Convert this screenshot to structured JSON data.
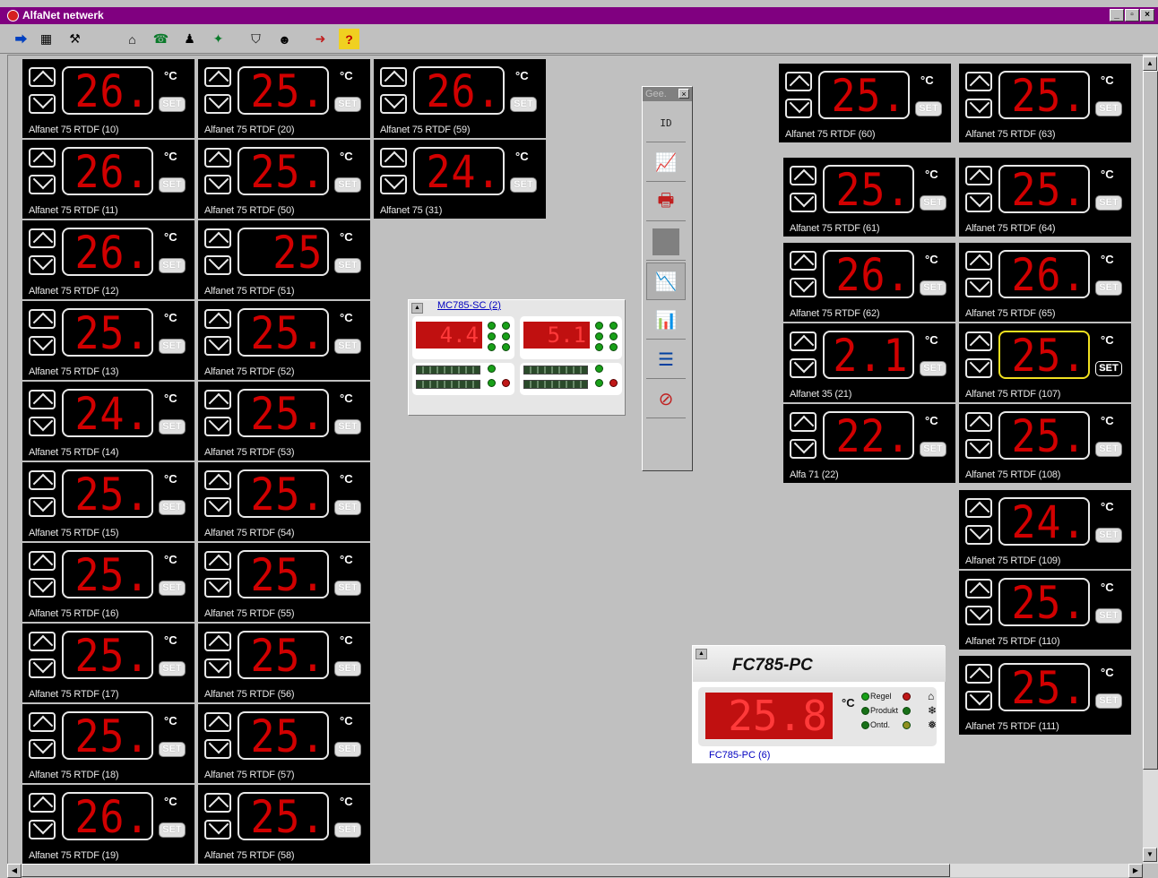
{
  "window": {
    "title": "AlfaNet netwerk",
    "minimize": "_",
    "maximize": "▫",
    "close": "×"
  },
  "toolbar_icons": [
    "exit-icon",
    "table-icon",
    "tools-icon",
    "fan-icon",
    "phone-icon",
    "network-icon",
    "run-icon",
    "lock-icon",
    "user-icon",
    "logout-icon",
    "help-icon"
  ],
  "controllers": [
    {
      "value": "26.4",
      "label": "Alfanet 75 RTDF (10)"
    },
    {
      "value": "26.0",
      "label": "Alfanet 75 RTDF (11)"
    },
    {
      "value": "26.3",
      "label": "Alfanet 75 RTDF (12)"
    },
    {
      "value": "25.4",
      "label": "Alfanet 75 RTDF (13)"
    },
    {
      "value": "24.9",
      "label": "Alfanet 75 RTDF (14)"
    },
    {
      "value": "25.7",
      "label": "Alfanet 75 RTDF (15)"
    },
    {
      "value": "25.2",
      "label": "Alfanet 75 RTDF (16)"
    },
    {
      "value": "25.7",
      "label": "Alfanet 75 RTDF (17)"
    },
    {
      "value": "25.4",
      "label": "Alfanet 75 RTDF (18)"
    },
    {
      "value": "26.0",
      "label": "Alfanet 75 RTDF (19)"
    },
    {
      "value": "25.9",
      "label": "Alfanet 75 RTDF (20)"
    },
    {
      "value": "25.7",
      "label": "Alfanet 75 RTDF (50)"
    },
    {
      "value": "25",
      "label": "Alfanet 75 RTDF (51)"
    },
    {
      "value": "25.8",
      "label": "Alfanet 75 RTDF (52)"
    },
    {
      "value": "25.8",
      "label": "Alfanet 75 RTDF (53)"
    },
    {
      "value": "25.2",
      "label": "Alfanet 75 RTDF (54)"
    },
    {
      "value": "25.6",
      "label": "Alfanet 75 RTDF (55)"
    },
    {
      "value": "25.5",
      "label": "Alfanet 75 RTDF (56)"
    },
    {
      "value": "25.4",
      "label": "Alfanet 75 RTDF (57)"
    },
    {
      "value": "25.5",
      "label": "Alfanet 75 RTDF (58)"
    },
    {
      "value": "26.3",
      "label": "Alfanet 75 RTDF (59)"
    },
    {
      "value": "24.9",
      "label": "Alfanet 75 (31)"
    },
    {
      "value": "25.7",
      "label": "Alfanet 75 RTDF (60)"
    },
    {
      "value": "25.0",
      "label": "Alfanet 75 RTDF (63)"
    },
    {
      "value": "25.2",
      "label": "Alfanet 75 RTDF (61)"
    },
    {
      "value": "25.1",
      "label": "Alfanet 75 RTDF (64)"
    },
    {
      "value": "26.1",
      "label": "Alfanet 75 RTDF (62)"
    },
    {
      "value": "26.2",
      "label": "Alfanet 75 RTDF (65)"
    },
    {
      "value": "2.1",
      "label": "Alfanet 35 (21)"
    },
    {
      "value": "25.0",
      "label": "Alfanet 75 RTDF (107)"
    },
    {
      "value": "22.9",
      "label": "Alfa 71 (22)"
    },
    {
      "value": "25.6",
      "label": "Alfanet 75 RTDF (108)"
    },
    {
      "value": "24.9",
      "label": "Alfanet 75 RTDF (109)"
    },
    {
      "value": "25.9",
      "label": "Alfanet 75 RTDF (110)"
    },
    {
      "value": "25.3",
      "label": "Alfanet 75 RTDF (111)"
    }
  ],
  "controller_common": {
    "unit": "°C",
    "set_label": "SET"
  },
  "mc785": {
    "title": "MC785-SC (2)",
    "display1": "4.4",
    "display2": "5.1"
  },
  "geeb": {
    "title": "Gee.",
    "close": "×",
    "id_label": "ID"
  },
  "fc785": {
    "title": "FC785-PC",
    "value": "25.8",
    "unit": "°C",
    "legend1": "Regel",
    "legend2": "Produkt",
    "legend3": "Ontd.",
    "link": "FC785-PC (6)"
  }
}
